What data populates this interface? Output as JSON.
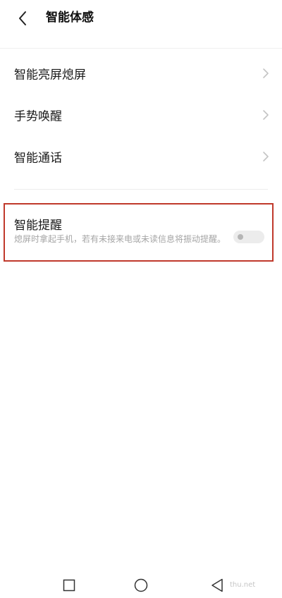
{
  "header": {
    "title": "智能体感",
    "back_icon": "back-arrow-icon"
  },
  "menu": {
    "items": [
      {
        "label": "智能亮屏熄屏",
        "icon": "chevron-right-icon"
      },
      {
        "label": "手势唤醒",
        "icon": "chevron-right-icon"
      },
      {
        "label": "智能通话",
        "icon": "chevron-right-icon"
      }
    ]
  },
  "smart_reminder": {
    "title": "智能提醒",
    "description": "熄屏时拿起手机，若有未接来电或未读信息将振动提醒。",
    "enabled": false
  },
  "nav_bar": {
    "buttons": [
      "recent-apps-icon",
      "home-icon",
      "back-triangle-icon"
    ]
  },
  "watermark": "thu.net",
  "colors": {
    "highlight_border": "#c0392b",
    "toggle_off": "#ececec",
    "secondary_text": "#a5a5a5"
  }
}
